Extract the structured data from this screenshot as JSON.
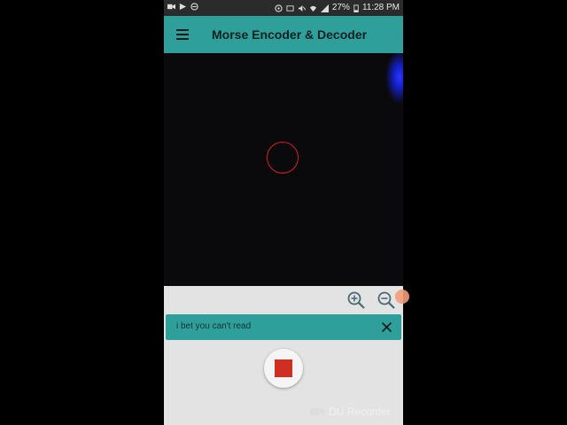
{
  "status_bar": {
    "battery": "27%",
    "time": "11:28 PM",
    "left_icons": [
      "video-icon",
      "play-store-icon",
      "dnd-icon"
    ],
    "right_icons": [
      "sync-icon",
      "cast-icon",
      "mute-icon",
      "wifi-icon",
      "signal-icon",
      "battery-icon"
    ]
  },
  "app_bar": {
    "title": "Morse Encoder & Decoder",
    "color": "#2f9f9b"
  },
  "decoder": {
    "decoded_text": "i bet you can't read"
  },
  "overlay": {
    "recorder_label": "DU Recorder"
  },
  "colors": {
    "accent": "#2f9f9b",
    "record_stop": "#cf2e25",
    "focus_ring": "#d91e1e"
  }
}
